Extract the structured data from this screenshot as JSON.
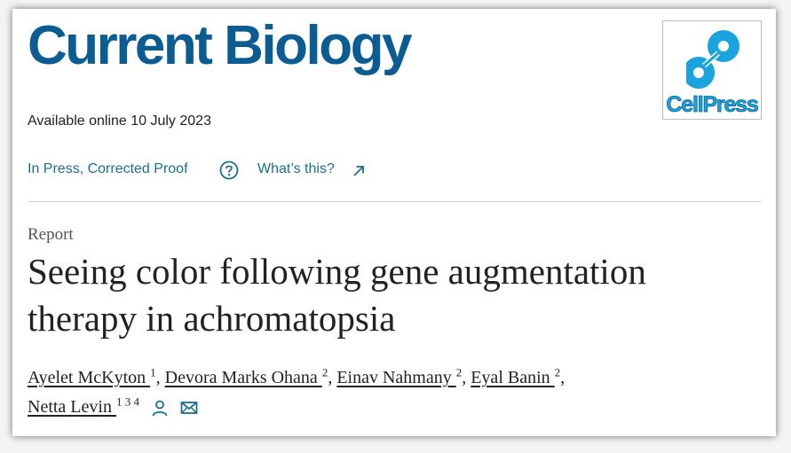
{
  "header": {
    "journal_title": "Current Biology",
    "publisher_logo_text": "CellPress",
    "publisher_logo_icon": "cellpress-logo-icon",
    "brand_color": "#0c5c94",
    "logo_color": "#1aa3dc"
  },
  "publication": {
    "available_online": "Available online 10 July 2023",
    "status_link": "In Press, Corrected Proof",
    "help_icon": "question-circle-icon",
    "whats_this_link": "What’s this?",
    "external_icon": "arrow-up-right-icon",
    "link_color": "#1a6f8d"
  },
  "article": {
    "type": "Report",
    "title_line1": "Seeing color following gene augmentation",
    "title_line2": "therapy in achromatopsia"
  },
  "authors": [
    {
      "name": "Ayelet McKyton ",
      "sup": "1",
      "after": ", "
    },
    {
      "name": "Devora Marks Ohana ",
      "sup": "2",
      "after": ", "
    },
    {
      "name": "Einav Nahmany ",
      "sup": "2",
      "after": ", "
    },
    {
      "name": "Eyal Banin ",
      "sup": "2",
      "after": ","
    },
    {
      "name": "Netta Levin ",
      "sup": "1 3 4",
      "after": ""
    }
  ],
  "author_icons": [
    "person-icon",
    "envelope-icon"
  ]
}
